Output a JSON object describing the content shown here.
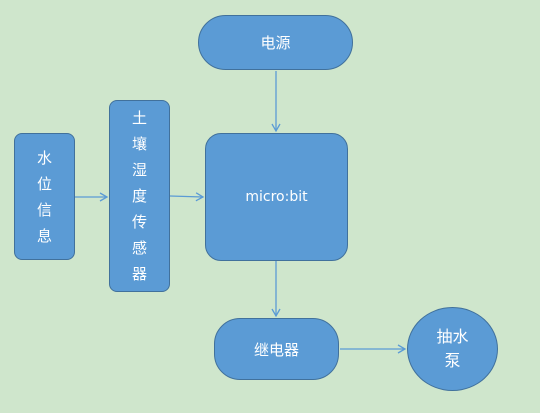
{
  "nodes": {
    "power": "电源",
    "water_level": "水位信息",
    "soil_sensor": "土壤湿度传感器",
    "microbit": "micro:bit",
    "relay": "继电器",
    "pump": "抽水泵"
  },
  "colors": {
    "background": "#cfe6cc",
    "node_fill": "#5b9bd5",
    "node_border": "#41719c",
    "arrow": "#5b9bd5",
    "text": "#ffffff"
  }
}
